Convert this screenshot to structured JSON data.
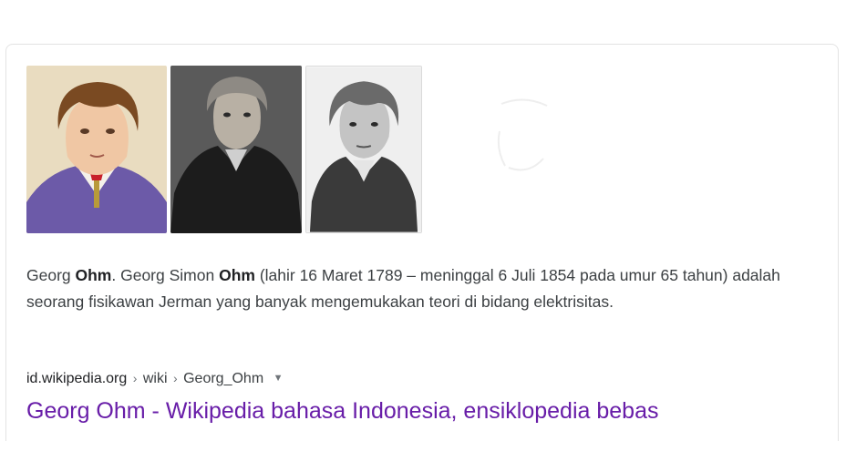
{
  "knowledge_panel": {
    "images": [
      {
        "alt": "Georg Ohm color portrait"
      },
      {
        "alt": "Georg Ohm photograph"
      },
      {
        "alt": "Georg Ohm engraving"
      }
    ],
    "snippet": {
      "part1": "Georg ",
      "bold1": "Ohm",
      "part2": ". Georg Simon ",
      "bold2": "Ohm",
      "part3": " (lahir 16 Maret 1789 – meninggal 6 Juli 1854 pada umur 65 tahun) adalah seorang fisikawan Jerman yang banyak mengemukakan teori di bidang elektrisitas."
    },
    "citation": {
      "domain": "id.wikipedia.org",
      "path1": "wiki",
      "path2": "Georg_Ohm",
      "separator": "›",
      "arrow": "▼"
    },
    "result_title": "Georg Ohm - Wikipedia bahasa Indonesia, ensiklopedia bebas",
    "colors": {
      "link": "#681da8",
      "text": "#3c4043"
    }
  }
}
